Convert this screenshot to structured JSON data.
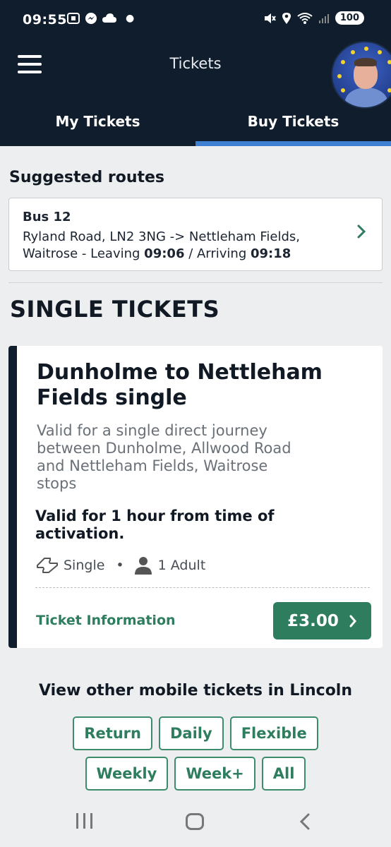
{
  "status_bar": {
    "time": "09:55",
    "battery": "100",
    "left_icons": [
      "screenshot-icon",
      "messenger-icon",
      "cloud-icon",
      "dot"
    ],
    "right_icons": [
      "mute-icon",
      "location-icon",
      "wifi-icon",
      "signal-icon",
      "battery-icon"
    ]
  },
  "header": {
    "title": "Tickets",
    "menu_icon": "hamburger-menu-icon",
    "avatar": "user-avatar"
  },
  "tabs": [
    {
      "label": "My Tickets",
      "active": false
    },
    {
      "label": "Buy Tickets",
      "active": true
    }
  ],
  "suggested": {
    "title": "Suggested routes",
    "route": {
      "bus": "Bus 12",
      "description_prefix": "Ryland Road, LN2 3NG -> Nettleham Fields, Waitrose - Leaving ",
      "leaving": "09:06",
      "separator": " / Arriving ",
      "arriving": "09:18"
    }
  },
  "single_tickets": {
    "title": "SINGLE TICKETS",
    "ticket": {
      "name": "Dunholme to Nettleham Fields single",
      "description": "Valid for a single direct journey between Dunholme, Allwood Road and Nettleham Fields, Waitrose stops",
      "validity": "Valid for 1 hour from time of activation.",
      "type": "Single",
      "passengers": "1 Adult",
      "info_link": "Ticket Information",
      "price": "£3.00"
    }
  },
  "other": {
    "title": "View other mobile tickets in Lincoln",
    "chips": [
      "Return",
      "Daily",
      "Flexible",
      "Weekly",
      "Week+",
      "All"
    ]
  },
  "colors": {
    "header_bg": "#0f1d2c",
    "accent_blue": "#3f7fd2",
    "green": "#2d7d5e",
    "page_bg": "#eceeef"
  }
}
